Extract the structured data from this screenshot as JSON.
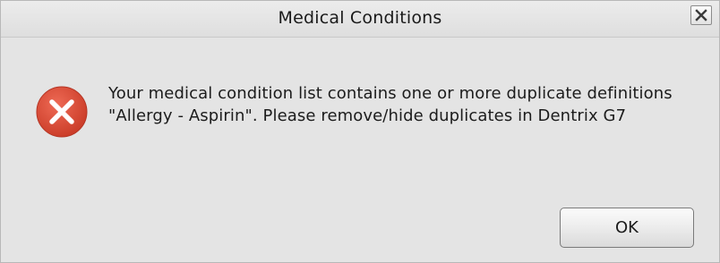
{
  "window": {
    "title": "Medical Conditions"
  },
  "icons": {
    "close": "close-icon",
    "error": "error-icon"
  },
  "message": {
    "text": "Your medical condition list contains one or more duplicate definitions \"Allergy - Aspirin\". Please remove/hide duplicates in Dentrix G7"
  },
  "buttons": {
    "ok_label": "OK"
  },
  "colors": {
    "error_red": "#d94a35",
    "dialog_bg": "#e4e4e4"
  }
}
